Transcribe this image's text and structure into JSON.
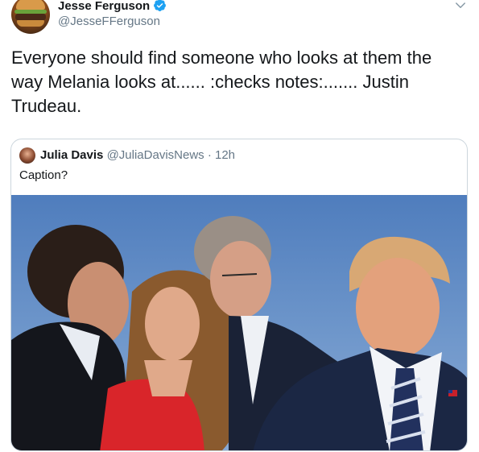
{
  "tweet": {
    "author": {
      "name": "Jesse Ferguson",
      "handle": "@JesseFFerguson",
      "verified": true,
      "avatar_icon": "burger-avatar-icon"
    },
    "text": "Everyone should find someone who looks at them the way Melania looks at...... :checks notes:....... Justin Trudeau."
  },
  "quoted_tweet": {
    "author": {
      "name": "Julia Davis",
      "handle": "@JuliaDavisNews",
      "separator": "·",
      "time": "12h"
    },
    "text": "Caption?"
  },
  "colors": {
    "accent": "#1da1f2",
    "text": "#14171a",
    "secondary": "#657786",
    "border": "#ccd6dd"
  }
}
